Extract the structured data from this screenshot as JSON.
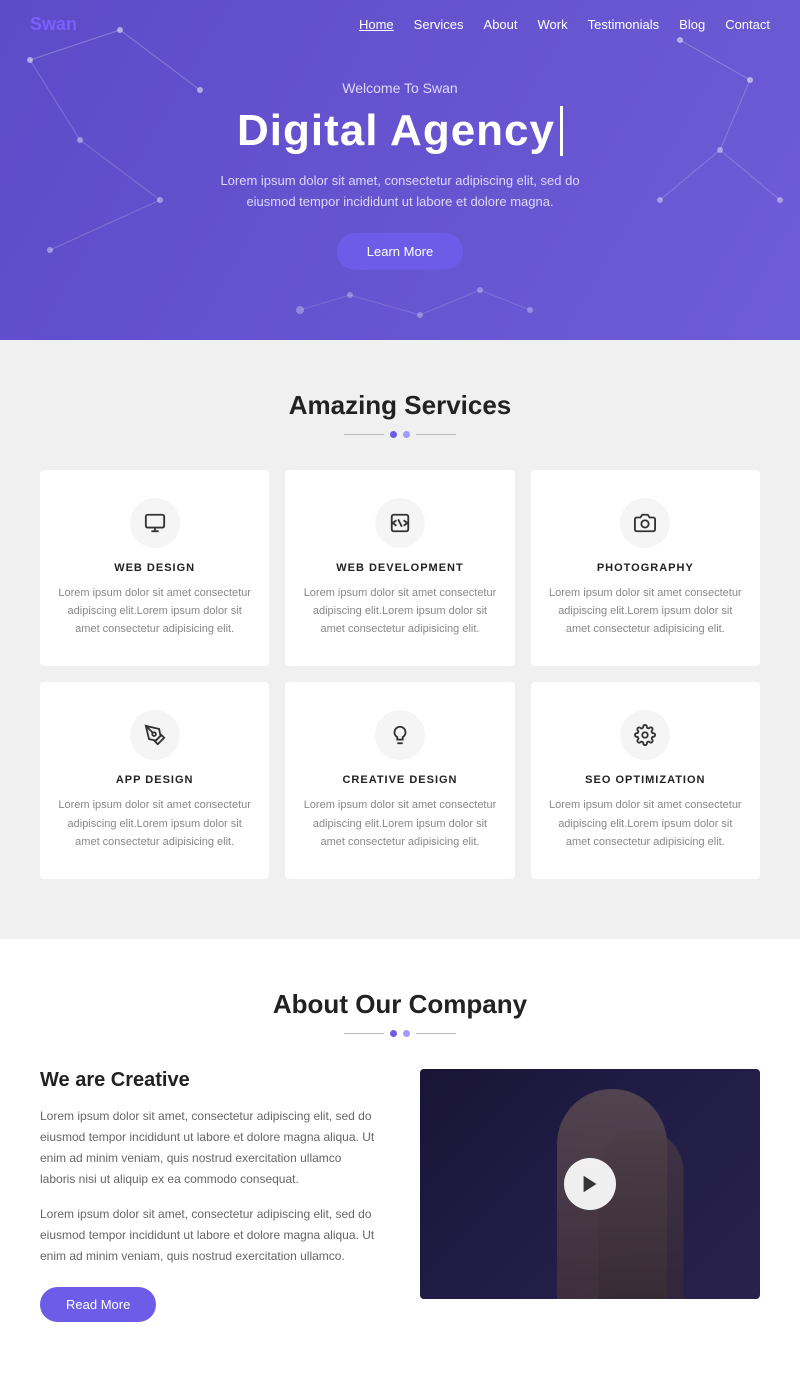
{
  "brand": "Swan",
  "nav": {
    "links": [
      {
        "label": "Home",
        "active": true
      },
      {
        "label": "Services",
        "active": false
      },
      {
        "label": "About",
        "active": false
      },
      {
        "label": "Work",
        "active": false
      },
      {
        "label": "Testimonials",
        "active": false
      },
      {
        "label": "Blog",
        "active": false
      },
      {
        "label": "Contact",
        "active": false
      }
    ]
  },
  "hero": {
    "welcome": "Welcome To Swan",
    "title": "Digital Agency",
    "description": "Lorem ipsum dolor sit amet, consectetur adipiscing elit, sed do eiusmod tempor incididunt ut labore et dolore magna.",
    "cta": "Learn More"
  },
  "services": {
    "title": "Amazing Services",
    "cards": [
      {
        "icon": "monitor",
        "title": "WEB DESIGN",
        "desc": "Lorem ipsum dolor sit amet consectetur adipiscing elit.Lorem ipsum dolor sit amet consectetur adipisicing elit."
      },
      {
        "icon": "code",
        "title": "WEB DEVELOPMENT",
        "desc": "Lorem ipsum dolor sit amet consectetur adipiscing elit.Lorem ipsum dolor sit amet consectetur adipisicing elit."
      },
      {
        "icon": "camera",
        "title": "PHOTOGRAPHY",
        "desc": "Lorem ipsum dolor sit amet consectetur adipiscing elit.Lorem ipsum dolor sit amet consectetur adipisicing elit."
      },
      {
        "icon": "pen",
        "title": "APP DESIGN",
        "desc": "Lorem ipsum dolor sit amet consectetur adipiscing elit.Lorem ipsum dolor sit amet consectetur adipisicing elit."
      },
      {
        "icon": "bulb",
        "title": "CREATIVE DESIGN",
        "desc": "Lorem ipsum dolor sit amet consectetur adipiscing elit.Lorem ipsum dolor sit amet consectetur adipisicing elit."
      },
      {
        "icon": "settings",
        "title": "SEO OPTIMIZATION",
        "desc": "Lorem ipsum dolor sit amet consectetur adipiscing elit.Lorem ipsum dolor sit amet consectetur adipisicing elit."
      }
    ]
  },
  "about": {
    "title": "About Our Company",
    "left_heading": "We are Creative",
    "para1": "Lorem ipsum dolor sit amet, consectetur adipiscing elit, sed do eiusmod tempor incididunt ut labore et dolore magna aliqua. Ut enim ad minim veniam, quis nostrud exercitation ullamco laboris nisi ut aliquip ex ea commodo consequat.",
    "para2": "Lorem ipsum dolor sit amet, consectetur adipiscing elit, sed do eiusmod tempor incididunt ut labore et dolore magna aliqua. Ut enim ad minim veniam, quis nostrud exercitation ullamco.",
    "cta": "Read More"
  }
}
